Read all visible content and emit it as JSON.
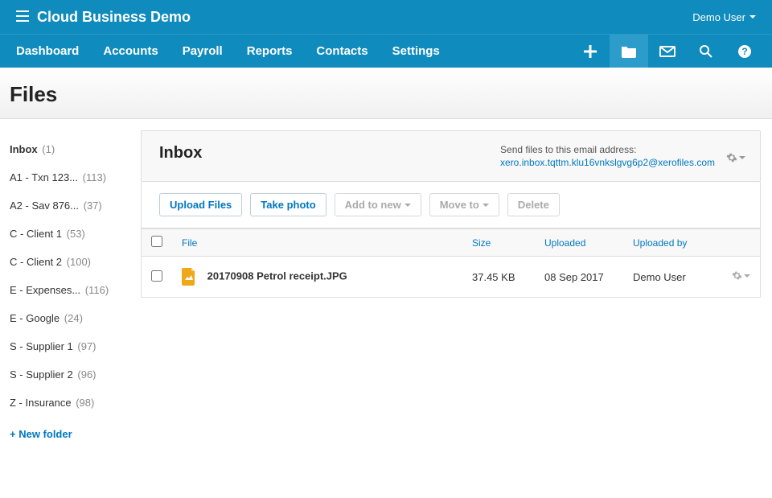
{
  "brand": {
    "title": "Cloud Business Demo",
    "user": "Demo User"
  },
  "nav": {
    "tabs": [
      "Dashboard",
      "Accounts",
      "Payroll",
      "Reports",
      "Contacts",
      "Settings"
    ]
  },
  "page": {
    "title": "Files"
  },
  "sidebar": {
    "folders": [
      {
        "label": "Inbox",
        "count": "(1)",
        "selected": true
      },
      {
        "label": "A1 - Txn 123...",
        "count": "(113)"
      },
      {
        "label": "A2 - Sav 876...",
        "count": "(37)"
      },
      {
        "label": "C - Client 1",
        "count": "(53)"
      },
      {
        "label": "C - Client 2",
        "count": "(100)"
      },
      {
        "label": "E - Expenses...",
        "count": "(116)"
      },
      {
        "label": "E - Google",
        "count": "(24)"
      },
      {
        "label": "S - Supplier 1",
        "count": "(97)"
      },
      {
        "label": "S - Supplier 2",
        "count": "(96)"
      },
      {
        "label": "Z - Insurance",
        "count": "(98)"
      }
    ],
    "new_folder": "+ New folder"
  },
  "panel": {
    "heading": "Inbox",
    "email_prompt": "Send files to this email address:",
    "email": "xero.inbox.tqttm.klu16vnkslgvg6p2@xerofiles.com"
  },
  "toolbar": {
    "upload": "Upload Files",
    "take_photo": "Take photo",
    "add_to_new": "Add to new",
    "move_to": "Move to",
    "delete": "Delete"
  },
  "table": {
    "headers": {
      "file": "File",
      "size": "Size",
      "uploaded": "Uploaded",
      "uploaded_by": "Uploaded by"
    },
    "rows": [
      {
        "file": "20170908 Petrol receipt.JPG",
        "size": "37.45 KB",
        "uploaded": "08 Sep 2017",
        "uploaded_by": "Demo User"
      }
    ]
  }
}
